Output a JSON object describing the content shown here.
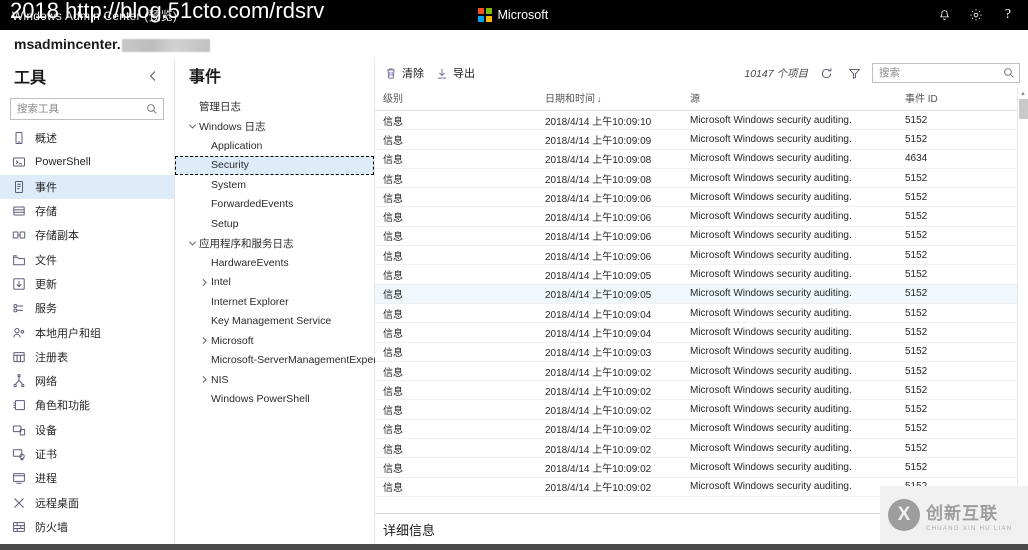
{
  "topbar": {
    "app_title": "Windows Admin Center (预览)",
    "brand_name": "Microsoft",
    "url_watermark": "2018 http://blog.51cto.com/rdsrv",
    "actions": [
      {
        "name": "notifications-icon",
        "label": "通知"
      },
      {
        "name": "settings-icon",
        "label": "设置"
      },
      {
        "name": "help-icon",
        "label": "?"
      }
    ]
  },
  "server": {
    "name": "msadmincenter."
  },
  "tools": {
    "title": "工具",
    "collapse_label": "折叠",
    "search_placeholder": "搜索工具",
    "search_value": "",
    "items": [
      {
        "label": "概述",
        "icon": "overview-icon",
        "selected": false
      },
      {
        "label": "PowerShell",
        "icon": "powershell-icon",
        "selected": false
      },
      {
        "label": "事件",
        "icon": "events-icon",
        "selected": true
      },
      {
        "label": "存储",
        "icon": "storage-icon",
        "selected": false
      },
      {
        "label": "存储副本",
        "icon": "storage-replica-icon",
        "selected": false
      },
      {
        "label": "文件",
        "icon": "files-icon",
        "selected": false
      },
      {
        "label": "更新",
        "icon": "updates-icon",
        "selected": false
      },
      {
        "label": "服务",
        "icon": "services-icon",
        "selected": false
      },
      {
        "label": "本地用户和组",
        "icon": "users-icon",
        "selected": false
      },
      {
        "label": "注册表",
        "icon": "registry-icon",
        "selected": false
      },
      {
        "label": "网络",
        "icon": "network-icon",
        "selected": false
      },
      {
        "label": "角色和功能",
        "icon": "roles-icon",
        "selected": false
      },
      {
        "label": "设备",
        "icon": "devices-icon",
        "selected": false
      },
      {
        "label": "证书",
        "icon": "certificates-icon",
        "selected": false
      },
      {
        "label": "进程",
        "icon": "processes-icon",
        "selected": false
      },
      {
        "label": "远程桌面",
        "icon": "remote-desktop-icon",
        "selected": false
      },
      {
        "label": "防火墙",
        "icon": "firewall-icon",
        "selected": false
      }
    ]
  },
  "events_tree": {
    "title": "事件",
    "nodes": [
      {
        "label": "管理日志",
        "indent": 0,
        "chevron": "none",
        "selected": false
      },
      {
        "label": "Windows 日志",
        "indent": 0,
        "chevron": "expanded",
        "selected": false
      },
      {
        "label": "Application",
        "indent": 1,
        "chevron": "none",
        "selected": false
      },
      {
        "label": "Security",
        "indent": 1,
        "chevron": "none",
        "selected": true
      },
      {
        "label": "System",
        "indent": 1,
        "chevron": "none",
        "selected": false
      },
      {
        "label": "ForwardedEvents",
        "indent": 1,
        "chevron": "none",
        "selected": false
      },
      {
        "label": "Setup",
        "indent": 1,
        "chevron": "none",
        "selected": false
      },
      {
        "label": "应用程序和服务日志",
        "indent": 0,
        "chevron": "expanded",
        "selected": false
      },
      {
        "label": "HardwareEvents",
        "indent": 1,
        "chevron": "none",
        "selected": false
      },
      {
        "label": "Intel",
        "indent": 1,
        "chevron": "collapsed",
        "selected": false
      },
      {
        "label": "Internet Explorer",
        "indent": 1,
        "chevron": "none",
        "selected": false
      },
      {
        "label": "Key Management Service",
        "indent": 1,
        "chevron": "none",
        "selected": false
      },
      {
        "label": "Microsoft",
        "indent": 1,
        "chevron": "collapsed",
        "selected": false
      },
      {
        "label": "Microsoft-ServerManagementExperience",
        "indent": 1,
        "chevron": "none",
        "selected": false
      },
      {
        "label": "NIS",
        "indent": 1,
        "chevron": "collapsed",
        "selected": false
      },
      {
        "label": "Windows PowerShell",
        "indent": 1,
        "chevron": "none",
        "selected": false
      }
    ]
  },
  "command_bar": {
    "clear_label": "清除",
    "export_label": "导出",
    "item_count": "10147 个项目",
    "refresh_label": "刷新",
    "filter_label": "筛选",
    "search_placeholder": "搜索",
    "search_value": ""
  },
  "grid": {
    "columns": [
      {
        "key": "level",
        "label": "级别",
        "sort": "none"
      },
      {
        "key": "date",
        "label": "日期和时间",
        "sort": "desc"
      },
      {
        "key": "source",
        "label": "源",
        "sort": "none"
      },
      {
        "key": "id",
        "label": "事件 ID",
        "sort": "none"
      }
    ],
    "rows": [
      {
        "level": "信息",
        "date": "2018/4/14 上午10:09:10",
        "source": "Microsoft Windows security auditing.",
        "id": "5152",
        "hovered": false
      },
      {
        "level": "信息",
        "date": "2018/4/14 上午10:09:09",
        "source": "Microsoft Windows security auditing.",
        "id": "5152",
        "hovered": false
      },
      {
        "level": "信息",
        "date": "2018/4/14 上午10:09:08",
        "source": "Microsoft Windows security auditing.",
        "id": "4634",
        "hovered": false
      },
      {
        "level": "信息",
        "date": "2018/4/14 上午10:09:08",
        "source": "Microsoft Windows security auditing.",
        "id": "5152",
        "hovered": false
      },
      {
        "level": "信息",
        "date": "2018/4/14 上午10:09:06",
        "source": "Microsoft Windows security auditing.",
        "id": "5152",
        "hovered": false
      },
      {
        "level": "信息",
        "date": "2018/4/14 上午10:09:06",
        "source": "Microsoft Windows security auditing.",
        "id": "5152",
        "hovered": false
      },
      {
        "level": "信息",
        "date": "2018/4/14 上午10:09:06",
        "source": "Microsoft Windows security auditing.",
        "id": "5152",
        "hovered": false
      },
      {
        "level": "信息",
        "date": "2018/4/14 上午10:09:06",
        "source": "Microsoft Windows security auditing.",
        "id": "5152",
        "hovered": false
      },
      {
        "level": "信息",
        "date": "2018/4/14 上午10:09:05",
        "source": "Microsoft Windows security auditing.",
        "id": "5152",
        "hovered": false
      },
      {
        "level": "信息",
        "date": "2018/4/14 上午10:09:05",
        "source": "Microsoft Windows security auditing.",
        "id": "5152",
        "hovered": true
      },
      {
        "level": "信息",
        "date": "2018/4/14 上午10:09:04",
        "source": "Microsoft Windows security auditing.",
        "id": "5152",
        "hovered": false
      },
      {
        "level": "信息",
        "date": "2018/4/14 上午10:09:04",
        "source": "Microsoft Windows security auditing.",
        "id": "5152",
        "hovered": false
      },
      {
        "level": "信息",
        "date": "2018/4/14 上午10:09:03",
        "source": "Microsoft Windows security auditing.",
        "id": "5152",
        "hovered": false
      },
      {
        "level": "信息",
        "date": "2018/4/14 上午10:09:02",
        "source": "Microsoft Windows security auditing.",
        "id": "5152",
        "hovered": false
      },
      {
        "level": "信息",
        "date": "2018/4/14 上午10:09:02",
        "source": "Microsoft Windows security auditing.",
        "id": "5152",
        "hovered": false
      },
      {
        "level": "信息",
        "date": "2018/4/14 上午10:09:02",
        "source": "Microsoft Windows security auditing.",
        "id": "5152",
        "hovered": false
      },
      {
        "level": "信息",
        "date": "2018/4/14 上午10:09:02",
        "source": "Microsoft Windows security auditing.",
        "id": "5152",
        "hovered": false
      },
      {
        "level": "信息",
        "date": "2018/4/14 上午10:09:02",
        "source": "Microsoft Windows security auditing.",
        "id": "5152",
        "hovered": false
      },
      {
        "level": "信息",
        "date": "2018/4/14 上午10:09:02",
        "source": "Microsoft Windows security auditing.",
        "id": "5152",
        "hovered": false
      },
      {
        "level": "信息",
        "date": "2018/4/14 上午10:09:02",
        "source": "Microsoft Windows security auditing.",
        "id": "5152",
        "hovered": false
      }
    ]
  },
  "details": {
    "title": "详细信息"
  },
  "watermark": {
    "main": "创新互联",
    "sub": "CHUANG XIN HU LIAN",
    "mark": "X"
  },
  "colors": {
    "accent": "#0078d4",
    "selection": "#deecf9",
    "hover": "#f0f8fd",
    "topbar": "#000000",
    "icon": "#5b5b7a"
  }
}
